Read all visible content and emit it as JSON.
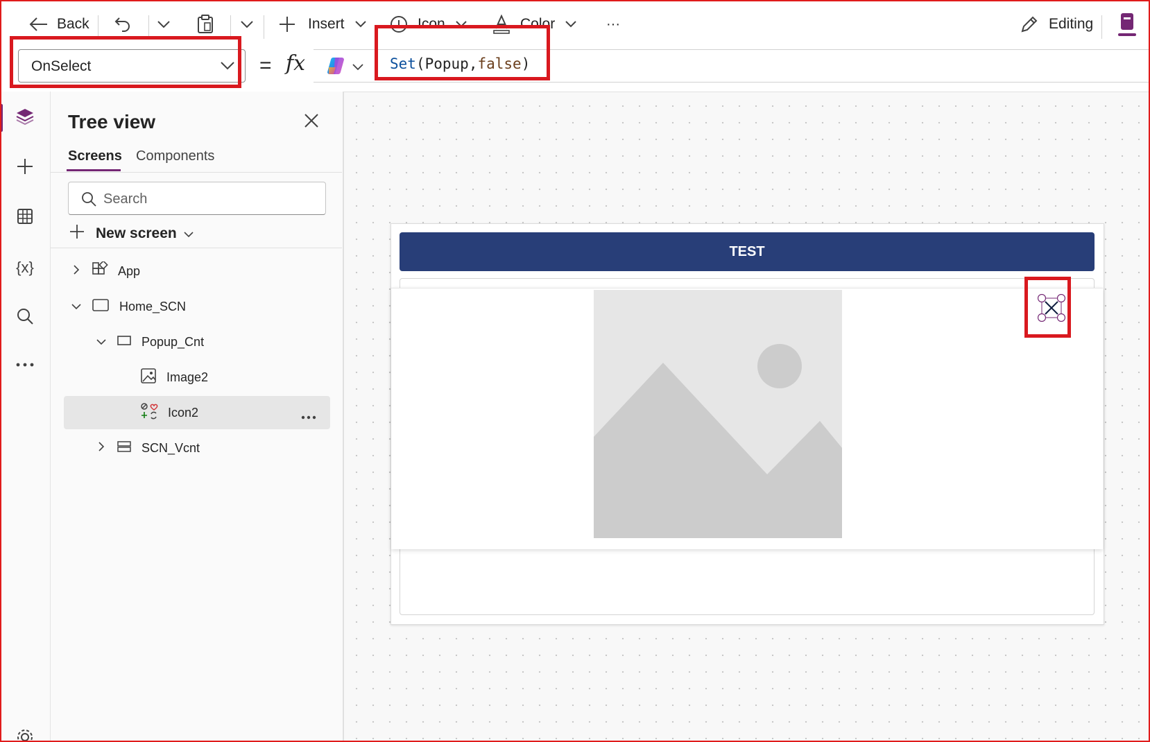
{
  "toolbar": {
    "back_label": "Back",
    "insert_label": "Insert",
    "icon_label": "Icon",
    "color_label": "Color",
    "more_label": "···",
    "editing_label": "Editing"
  },
  "formula_bar": {
    "property": "OnSelect",
    "equals": "=",
    "fx": "fx",
    "code_func": "Set",
    "code_open": "(",
    "code_var": "Popup",
    "code_comma": ",",
    "code_value": "false",
    "code_close": ")"
  },
  "tree_view": {
    "title": "Tree view",
    "tabs": [
      "Screens",
      "Components"
    ],
    "search_placeholder": "Search",
    "new_screen_label": "New screen",
    "nodes": {
      "app": "App",
      "home": "Home_SCN",
      "popup": "Popup_Cnt",
      "image": "Image2",
      "icon": "Icon2",
      "vcnt": "SCN_Vcnt"
    }
  },
  "canvas": {
    "header_text": "TEST"
  },
  "colors": {
    "accent": "#742774",
    "header_bg": "#283e78",
    "highlight": "#d9191f"
  }
}
